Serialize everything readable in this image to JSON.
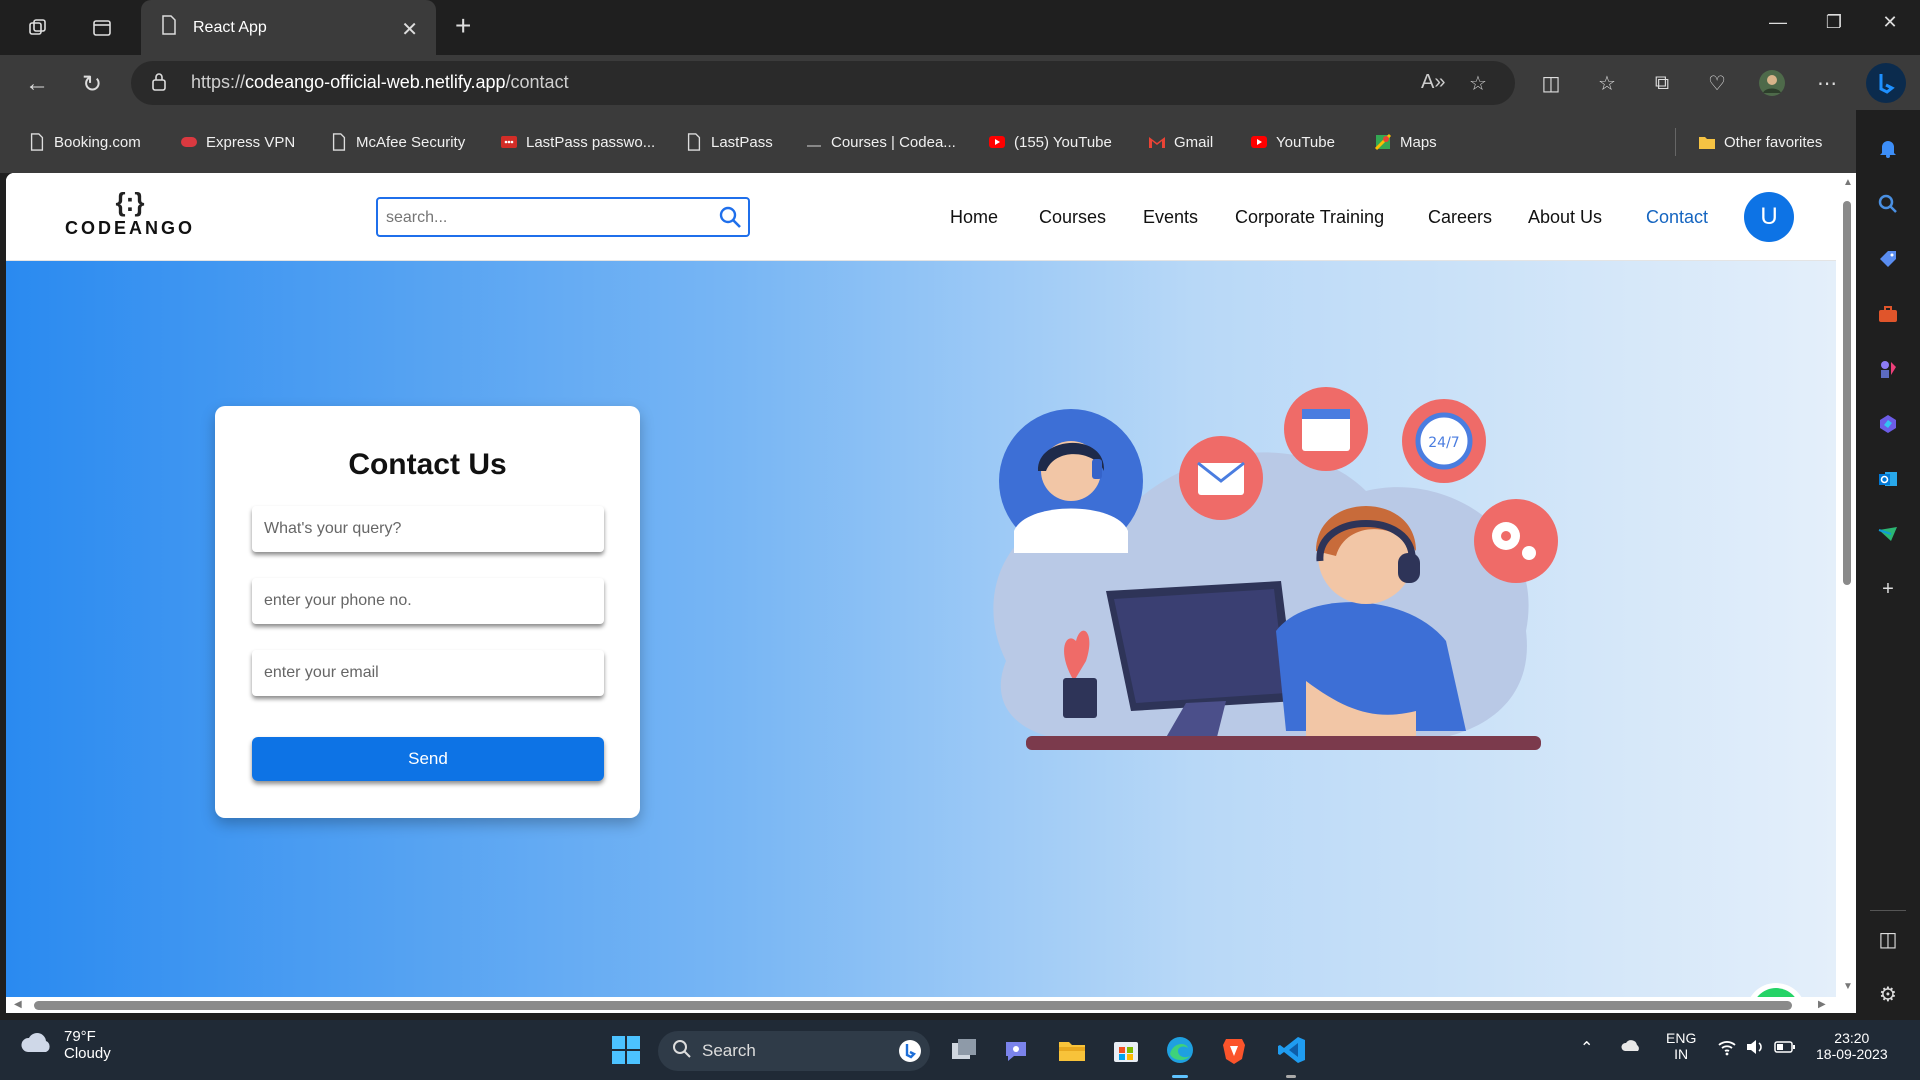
{
  "browser": {
    "tab_title": "React App",
    "url_prefix": "https://",
    "url_host": "codeango-official-web.netlify.app",
    "url_path": "/contact"
  },
  "favorites": [
    {
      "label": "Booking.com",
      "icon": "page-icon"
    },
    {
      "label": "Express VPN",
      "icon": "expressvpn-icon"
    },
    {
      "label": "McAfee Security",
      "icon": "page-icon"
    },
    {
      "label": "LastPass passwo...",
      "icon": "lastpass-icon"
    },
    {
      "label": "LastPass",
      "icon": "page-icon"
    },
    {
      "label": "Courses | Codea...",
      "icon": "codeango-icon"
    },
    {
      "label": "(155) YouTube",
      "icon": "youtube-icon"
    },
    {
      "label": "Gmail",
      "icon": "gmail-icon"
    },
    {
      "label": "YouTube",
      "icon": "youtube-icon"
    },
    {
      "label": "Maps",
      "icon": "maps-icon"
    }
  ],
  "other_favorites": "Other favorites",
  "site": {
    "logo_mark": "{:}",
    "logo_text": "CODEANGO",
    "search_placeholder": "search...",
    "nav": [
      "Home",
      "Courses",
      "Events",
      "Corporate Training",
      "Careers",
      "About Us",
      "Contact"
    ],
    "active_nav": "Contact",
    "avatar_letter": "U"
  },
  "contact_form": {
    "title": "Contact Us",
    "query_placeholder": "What's your query?",
    "phone_placeholder": "enter your phone no.",
    "email_placeholder": "enter your email",
    "send_label": "Send"
  },
  "colors": {
    "accent": "#0d73e5",
    "nav_active": "#1565c0",
    "hero_start": "#2a8af0",
    "hero_end": "#e4effa"
  },
  "taskbar": {
    "temperature": "79°F",
    "condition": "Cloudy",
    "search_label": "Search",
    "lang": "ENG",
    "region": "IN",
    "time": "23:20",
    "date": "18-09-2023"
  }
}
